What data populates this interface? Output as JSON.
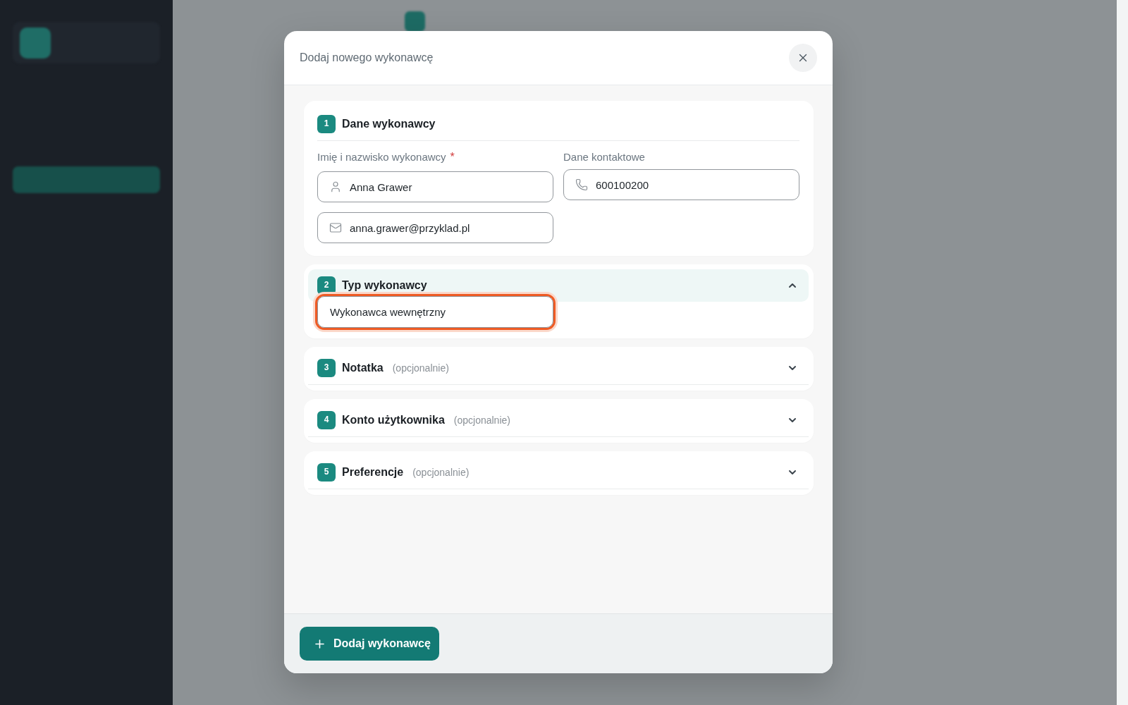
{
  "dialog": {
    "title": "Dodaj nowego wykonawcę"
  },
  "sections": [
    {
      "kind": "fields",
      "number": "1",
      "title": "Dane wykonawcy",
      "columns": [
        {
          "label": "Imię i nazwisko wykonawcy",
          "required_mark": "*",
          "fields": [
            {
              "kind": "person",
              "value": "Anna Grawer"
            },
            {
              "kind": "email",
              "value": "anna.grawer@przyklad.pl"
            }
          ]
        },
        {
          "label": "Dane kontaktowe",
          "fields": [
            {
              "kind": "phone",
              "value": "600100200"
            }
          ]
        }
      ]
    },
    {
      "kind": "accordion",
      "number": "2",
      "title": "Typ wykonawcy",
      "expanded": true,
      "field": {
        "value": "Wykonawca wewnętrzny",
        "focused": true
      }
    },
    {
      "kind": "accordion",
      "number": "3",
      "title": "Notatka",
      "hint": "(opcjonalnie)",
      "expanded": false
    },
    {
      "kind": "accordion",
      "number": "4",
      "title": "Konto użytkownika",
      "hint": "(opcjonalnie)",
      "expanded": false
    },
    {
      "kind": "accordion",
      "number": "5",
      "title": "Preferencje",
      "hint": "(opcjonalnie)",
      "expanded": false
    }
  ],
  "submit_button": {
    "label": "Dodaj wykonawcę"
  }
}
